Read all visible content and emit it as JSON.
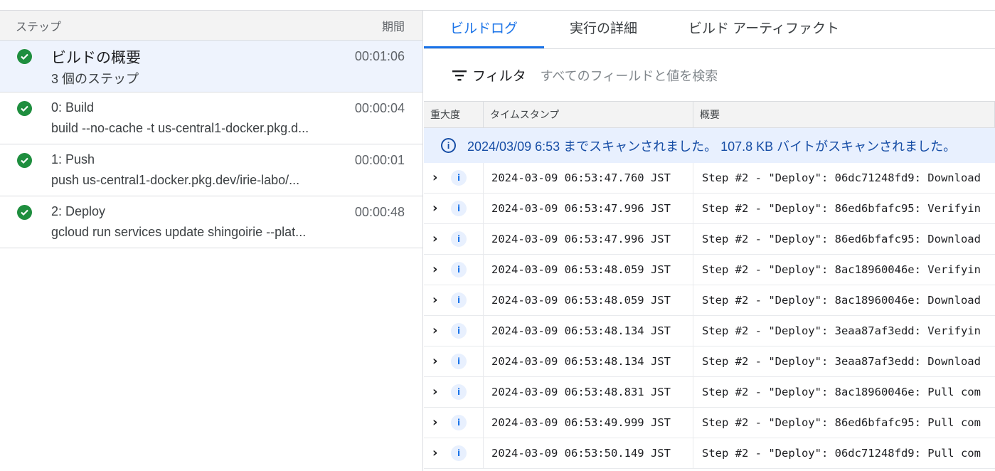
{
  "steps_panel": {
    "header_step": "ステップ",
    "header_duration": "期間",
    "steps": [
      {
        "title": "ビルドの概要",
        "subtitle": "3 個のステップ",
        "duration": "00:01:06",
        "status": "success",
        "selected": true
      },
      {
        "title": "0: Build",
        "subtitle": "build --no-cache -t us-central1-docker.pkg.d...",
        "duration": "00:00:04",
        "status": "success"
      },
      {
        "title": "1: Push",
        "subtitle": "push us-central1-docker.pkg.dev/irie-labo/...",
        "duration": "00:00:01",
        "status": "success"
      },
      {
        "title": "2: Deploy",
        "subtitle": "gcloud run services update shingoirie --plat...",
        "duration": "00:00:48",
        "status": "success"
      }
    ]
  },
  "tabs": [
    {
      "label": "ビルドログ",
      "active": true
    },
    {
      "label": "実行の詳細"
    },
    {
      "label": "ビルド アーティファクト"
    }
  ],
  "filter": {
    "label": "フィルタ",
    "placeholder": "すべてのフィールドと値を検索",
    "icon": "filter-icon"
  },
  "table": {
    "headers": [
      "重大度",
      "タイムスタンプ",
      "概要"
    ],
    "banner": "2024/03/09 6:53 までスキャンされました。 107.8 KB バイトがスキャンされました。",
    "rows": [
      {
        "severity": "info",
        "timestamp": "2024-03-09 06:53:47.760 JST",
        "summary": "Step #2 - \"Deploy\": 06dc71248fd9: Download"
      },
      {
        "severity": "info",
        "timestamp": "2024-03-09 06:53:47.996 JST",
        "summary": "Step #2 - \"Deploy\": 86ed6bfafc95: Verifyin"
      },
      {
        "severity": "info",
        "timestamp": "2024-03-09 06:53:47.996 JST",
        "summary": "Step #2 - \"Deploy\": 86ed6bfafc95: Download"
      },
      {
        "severity": "info",
        "timestamp": "2024-03-09 06:53:48.059 JST",
        "summary": "Step #2 - \"Deploy\": 8ac18960046e: Verifyin"
      },
      {
        "severity": "info",
        "timestamp": "2024-03-09 06:53:48.059 JST",
        "summary": "Step #2 - \"Deploy\": 8ac18960046e: Download"
      },
      {
        "severity": "info",
        "timestamp": "2024-03-09 06:53:48.134 JST",
        "summary": "Step #2 - \"Deploy\": 3eaa87af3edd: Verifyin"
      },
      {
        "severity": "info",
        "timestamp": "2024-03-09 06:53:48.134 JST",
        "summary": "Step #2 - \"Deploy\": 3eaa87af3edd: Download"
      },
      {
        "severity": "info",
        "timestamp": "2024-03-09 06:53:48.831 JST",
        "summary": "Step #2 - \"Deploy\": 8ac18960046e: Pull com"
      },
      {
        "severity": "info",
        "timestamp": "2024-03-09 06:53:49.999 JST",
        "summary": "Step #2 - \"Deploy\": 86ed6bfafc95: Pull com"
      },
      {
        "severity": "info",
        "timestamp": "2024-03-09 06:53:50.149 JST",
        "summary": "Step #2 - \"Deploy\": 06dc71248fd9: Pull com"
      }
    ]
  },
  "colors": {
    "accent": "#1a73e8",
    "success": "#1e8e3e",
    "selected_bg": "#eef3fd",
    "banner_bg": "#e8f0fe"
  }
}
